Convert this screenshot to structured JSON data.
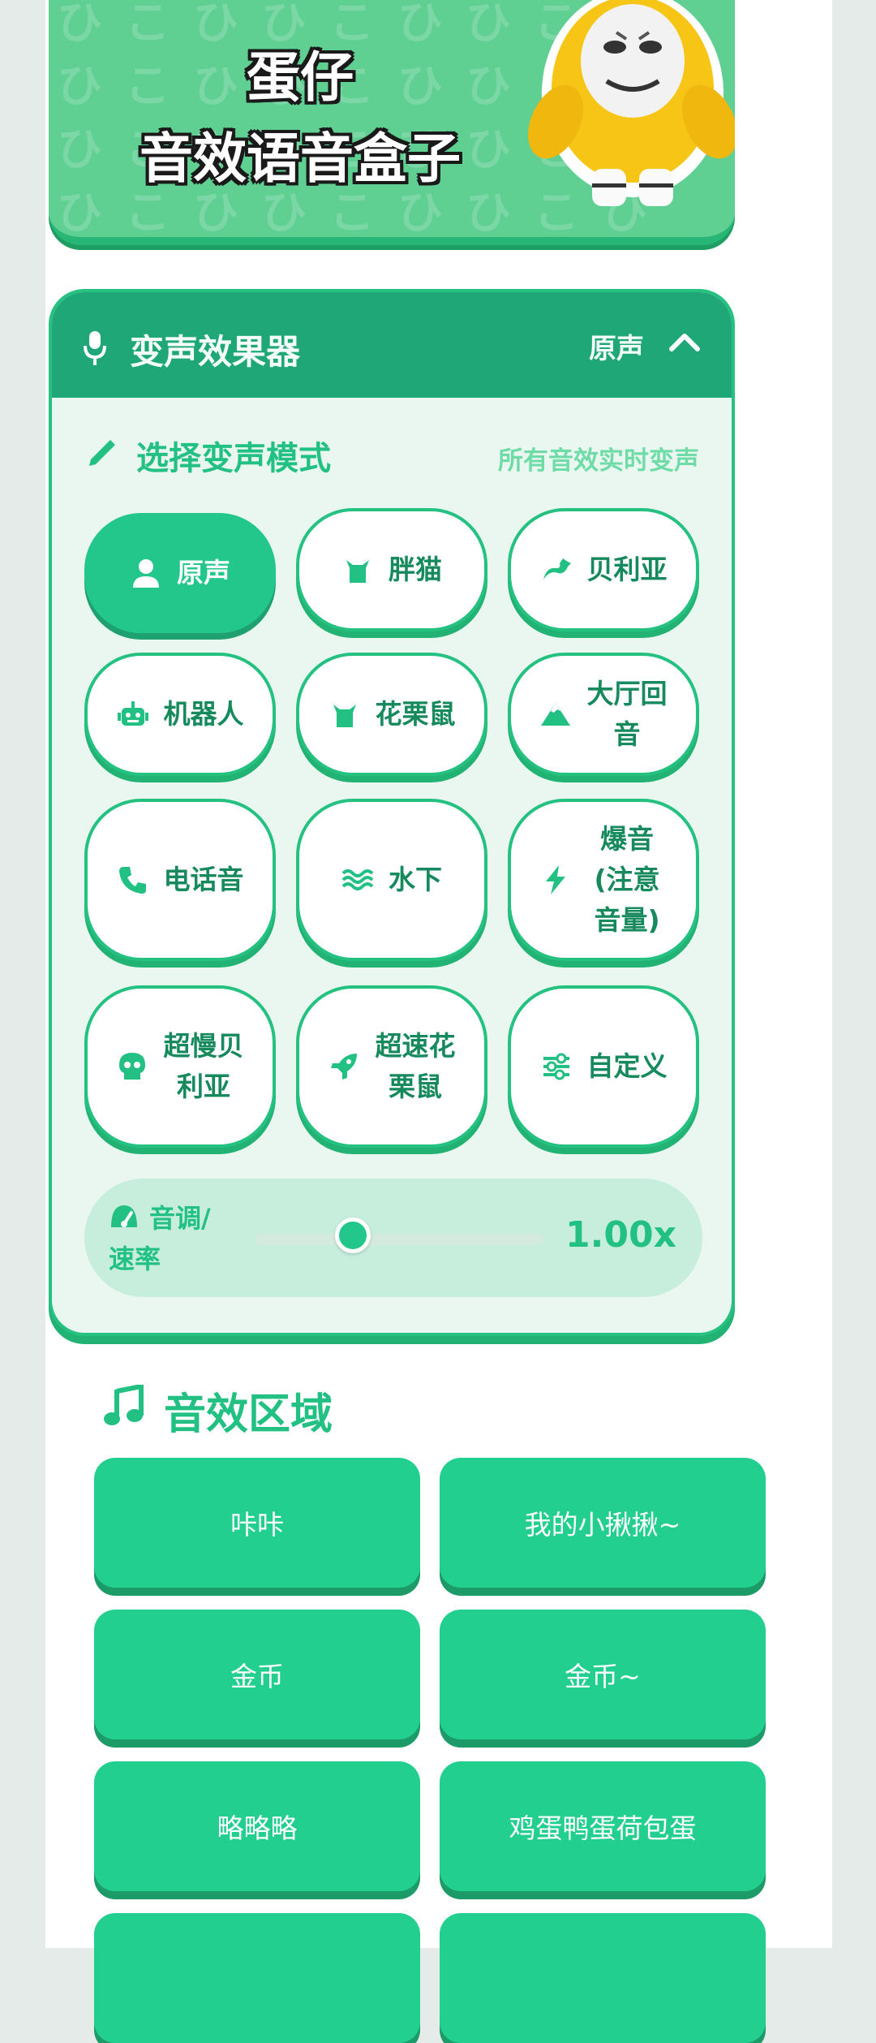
{
  "banner": {
    "title_line1": "蛋仔",
    "title_line2": "音效语音盒子",
    "pattern_text": "ひこひひこひひこひひこひひこひひこひひこひひこひひこひひこひひこひひこひひこひ"
  },
  "voice_changer": {
    "title": "变声效果器",
    "current_effect": "原声",
    "mode_label": "选择变声模式",
    "mode_hint": "所有音效实时变声",
    "modes": [
      {
        "label": "原声",
        "icon": "user-icon",
        "active": true
      },
      {
        "label": "胖猫",
        "icon": "cat-icon"
      },
      {
        "label": "贝利亚",
        "icon": "dragon-icon"
      },
      {
        "label": "机器人",
        "icon": "robot-icon"
      },
      {
        "label": "花栗鼠",
        "icon": "cat-icon"
      },
      {
        "label": "大厅回音",
        "icon": "mountain-icon"
      },
      {
        "label": "电话音",
        "icon": "phone-icon"
      },
      {
        "label": "水下",
        "icon": "water-icon"
      },
      {
        "label": "爆音(注意音量)",
        "icon": "bolt-icon"
      },
      {
        "label": "超慢贝利亚",
        "icon": "skull-icon"
      },
      {
        "label": "超速花栗鼠",
        "icon": "rocket-icon"
      },
      {
        "label": "自定义",
        "icon": "sliders-icon"
      }
    ],
    "pitch_label": "音调/速率",
    "pitch_value": "1.00x",
    "pitch_level": 0.34
  },
  "sfx": {
    "title": "音效区域",
    "items": [
      "咔咔",
      "我的小揪揪~",
      "金币",
      "金币~",
      "略略略",
      "鸡蛋鸭蛋荷包蛋",
      "",
      ""
    ]
  },
  "colors": {
    "accent": "#23c78c",
    "accent_dark": "#1fa777",
    "banner_green": "#5fcf92",
    "text_green": "#178a5d"
  }
}
